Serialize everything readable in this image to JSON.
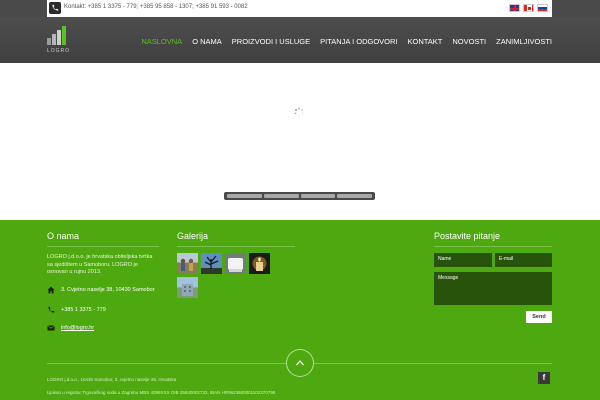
{
  "topbar": {
    "contact": "Kontakt: +385 1 3375 - 779; +385 95 858 - 1307; +385 91 593 - 0082",
    "flags": [
      "uk-flag-icon",
      "canada-flag-icon",
      "russia-flag-icon"
    ]
  },
  "header": {
    "logo_text": "LOGRO",
    "nav": [
      "NASLOVNA",
      "O NAMA",
      "PROIZVODI I USLUGE",
      "PITANJA I ODGOVORI",
      "KONTAKT",
      "NOVOSTI",
      "ZANIMLJIVOSTI"
    ],
    "active_nav": "NASLOVNA",
    "active_color": "#59c41b"
  },
  "footer": {
    "about": {
      "title": "O nama",
      "text": "LOGRO j.d.o.o. je hrvatska obiteljska tvrtka sa sjedištem u Samoboru. LOGRO je osnovan u rujnu 2013.",
      "address": "3. Cvjetno naselje 38, 10430 Samobor",
      "phone": "+385 1 3375 - 779",
      "email": "info@logro.hr"
    },
    "gallery": {
      "title": "Galerija",
      "thumbs": [
        "gallery-thumb-people",
        "gallery-thumb-tree",
        "gallery-thumb-white",
        "gallery-thumb-candle",
        "gallery-thumb-building"
      ]
    },
    "contact_form": {
      "title": "Postavite pitanje",
      "name_placeholder": "Name",
      "email_placeholder": "E-mail",
      "message_placeholder": "Message",
      "send_label": "Send"
    },
    "legal_line1": "LOGRO j.d.o.o., 10430 Samobor, 3. cvjetno naselje 38, Hrvatska",
    "legal_line2": "Upisan u registar Trgovačkog suda u Zagrebu MBS 4099XXX OIB 25840002732, IBAN HR9623600001102370798",
    "accent_color": "#4ea80f"
  }
}
